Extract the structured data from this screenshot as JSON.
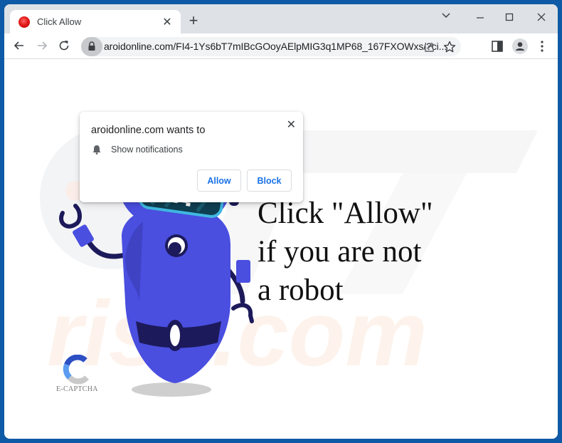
{
  "colors": {
    "desktop_background": "#0f5aa6",
    "tabstrip": "#dee1e6",
    "link_blue": "#1a73e8",
    "robot_body": "#4a4fe0",
    "robot_dark": "#1c1a5a",
    "robot_visor": "#0f3f52",
    "robot_visor_border": "#3fb8e0"
  },
  "browser": {
    "tab": {
      "favicon": "red-circle-favicon",
      "title": "Click Allow",
      "close_label": "✕"
    },
    "new_tab_label": "+",
    "window_controls": [
      "tab-search",
      "minimize",
      "maximize",
      "close"
    ],
    "toolbar": {
      "url": "aroidonline.com/FI4-1Ys6bT7mIBcGOoyAElpMIG3q1MP68_167FXOWxs/?ci...",
      "icons": [
        "back-icon",
        "forward-icon",
        "reload-icon",
        "lock-icon",
        "share-icon",
        "bookmark-star-icon",
        "side-panel-icon",
        "profile-icon",
        "menu-icon"
      ]
    }
  },
  "popup": {
    "title": "aroidonline.com wants to",
    "permission": "Show notifications",
    "close_label": "✕",
    "allow_label": "Allow",
    "block_label": "Block"
  },
  "page": {
    "headline_lines": [
      "Click \"Allow\"",
      "if you are not",
      "a robot"
    ],
    "captcha_label": "E-CAPTCHA",
    "watermark_text": "risk.com"
  }
}
